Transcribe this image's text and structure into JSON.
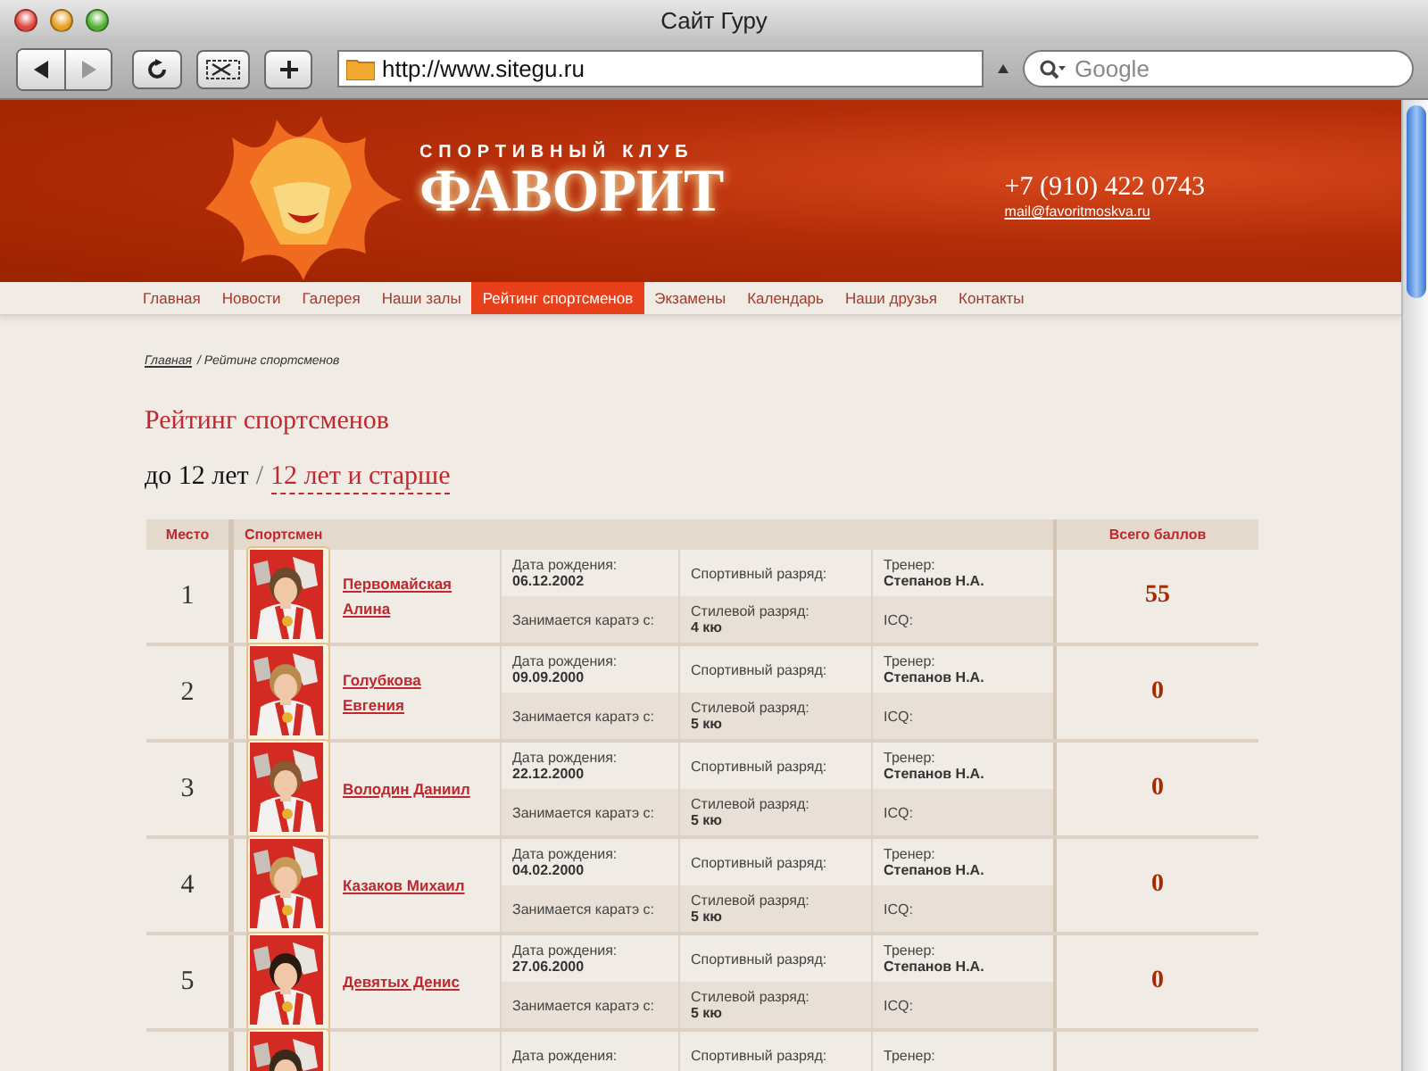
{
  "window": {
    "title": "Сайт Гуру"
  },
  "toolbar": {
    "url": "http://www.sitegu.ru",
    "search": {
      "placeholder": "Google"
    }
  },
  "header": {
    "club_caption": "СПОРТИВНЫЙ КЛУБ",
    "club_name": "ФАВОРИТ",
    "phone": "+7 (910) 422 0743",
    "email": "mail@favoritmoskva.ru"
  },
  "nav": [
    {
      "label": "Главная",
      "selected": false
    },
    {
      "label": "Новости",
      "selected": false
    },
    {
      "label": "Галерея",
      "selected": false
    },
    {
      "label": "Наши залы",
      "selected": false
    },
    {
      "label": "Рейтинг спортсменов",
      "selected": true
    },
    {
      "label": "Экзамены",
      "selected": false
    },
    {
      "label": "Календарь",
      "selected": false
    },
    {
      "label": "Наши друзья",
      "selected": false
    },
    {
      "label": "Контакты",
      "selected": false
    }
  ],
  "breadcrumb": {
    "link": "Главная",
    "current": "/ Рейтинг спортсменов"
  },
  "page_title": "Рейтинг спортсменов",
  "age_filter": [
    {
      "label": "до 12 лет",
      "selected": true
    },
    {
      "label": "12 лет и старше",
      "selected": false
    }
  ],
  "age_separator": "/",
  "table": {
    "columns": [
      "Место",
      "Спортсмен",
      "Всего баллов"
    ],
    "rows": [
      {
        "place": "1",
        "name": "Первомайская Алина",
        "birth_label": "Дата рождения:",
        "birth_date": "06.12.2002",
        "karate_label": "Занимается каратэ с:",
        "sport_rank_label": "Спортивный разряд:",
        "style_rank_label": "Стилевой разряд:",
        "style_rank": "4 кю",
        "coach_label": "Тренер:",
        "coach": "Степанов Н.А.",
        "icq_label": "ICQ:",
        "score": "55"
      },
      {
        "place": "2",
        "name": "Голубкова Евгения",
        "birth_label": "Дата рождения:",
        "birth_date": "09.09.2000",
        "karate_label": "Занимается каратэ с:",
        "sport_rank_label": "Спортивный разряд:",
        "style_rank_label": "Стилевой разряд:",
        "style_rank": "5 кю",
        "coach_label": "Тренер:",
        "coach": "Степанов Н.А.",
        "icq_label": "ICQ:",
        "score": "0"
      },
      {
        "place": "3",
        "name": "Володин Даниил",
        "birth_label": "Дата рождения:",
        "birth_date": "22.12.2000",
        "karate_label": "Занимается каратэ с:",
        "sport_rank_label": "Спортивный разряд:",
        "style_rank_label": "Стилевой разряд:",
        "style_rank": "5 кю",
        "coach_label": "Тренер:",
        "coach": "Степанов Н.А.",
        "icq_label": "ICQ:",
        "score": "0"
      },
      {
        "place": "4",
        "name": "Казаков Михаил",
        "birth_label": "Дата рождения:",
        "birth_date": "04.02.2000",
        "karate_label": "Занимается каратэ с:",
        "sport_rank_label": "Спортивный разряд:",
        "style_rank_label": "Стилевой разряд:",
        "style_rank": "5 кю",
        "coach_label": "Тренер:",
        "coach": "Степанов Н.А.",
        "icq_label": "ICQ:",
        "score": "0"
      },
      {
        "place": "5",
        "name": "Девятых Денис",
        "birth_label": "Дата рождения:",
        "birth_date": "27.06.2000",
        "karate_label": "Занимается каратэ с:",
        "sport_rank_label": "Спортивный разряд:",
        "style_rank_label": "Стилевой разряд:",
        "style_rank": "5 кю",
        "coach_label": "Тренер:",
        "coach": "Степанов Н.А.",
        "icq_label": "ICQ:",
        "score": "0"
      },
      {
        "birth_label": "Дата рождения:",
        "sport_rank_label": "Спортивный разряд:",
        "coach_label": "Тренер:"
      }
    ]
  }
}
